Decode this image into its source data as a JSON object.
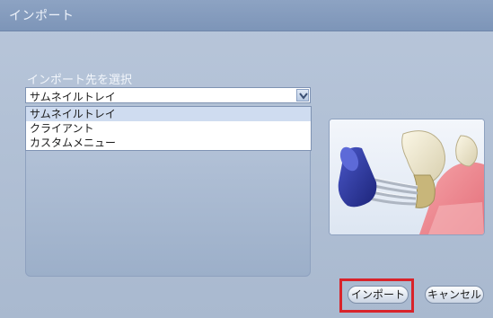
{
  "dialog": {
    "title": "インポート"
  },
  "destination": {
    "label": "インポート先を選択",
    "selected": "サムネイルトレイ",
    "options": [
      "サムネイルトレイ",
      "クライアント",
      "カスタムメニュー"
    ]
  },
  "preview": {
    "icon": "dental-floss-illustration"
  },
  "buttons": {
    "import_label": "インポート",
    "cancel_label": "キャンセル"
  },
  "colors": {
    "highlight": "#d8232a",
    "dialog_bg": "#aebdd3",
    "titlebar": "#7d95b8"
  }
}
